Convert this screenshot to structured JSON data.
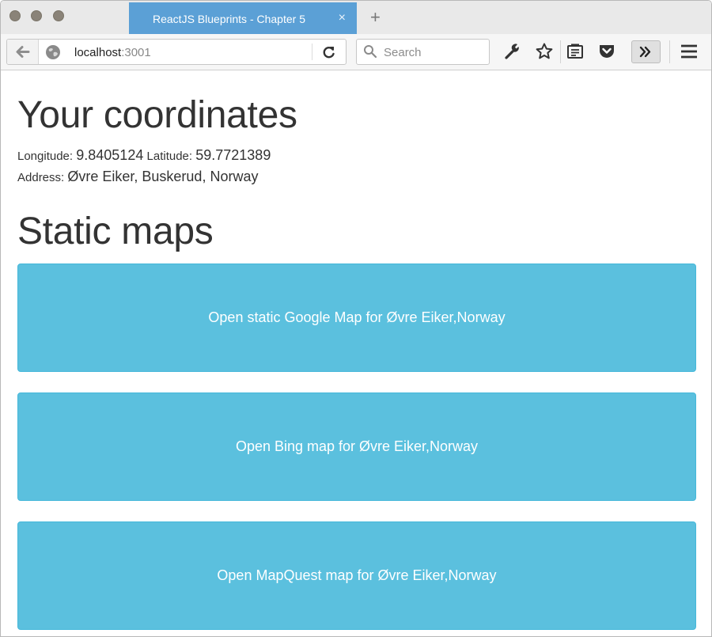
{
  "browser": {
    "tab_title": "ReactJS Blueprints - Chapter 5",
    "tab_close": "×",
    "new_tab": "+",
    "url_host": "localhost",
    "url_port": ":3001",
    "search_placeholder": "Search",
    "overflow_label": "»"
  },
  "page": {
    "coords_heading": "Your coordinates",
    "longitude_label": "Longitude:",
    "longitude_value": "9.8405124",
    "latitude_label": "Latitude:",
    "latitude_value": "59.7721389",
    "address_label": "Address:",
    "address_value": "Øvre Eiker, Buskerud, Norway",
    "maps_heading": "Static maps",
    "buttons": [
      {
        "label": "Open static Google Map for Øvre Eiker,Norway"
      },
      {
        "label": "Open Bing map for Øvre Eiker,Norway"
      },
      {
        "label": "Open MapQuest map for Øvre Eiker,Norway"
      }
    ]
  },
  "colors": {
    "tab_active": "#5ba0d6",
    "button_info": "#5bc0de",
    "text": "#333333"
  }
}
